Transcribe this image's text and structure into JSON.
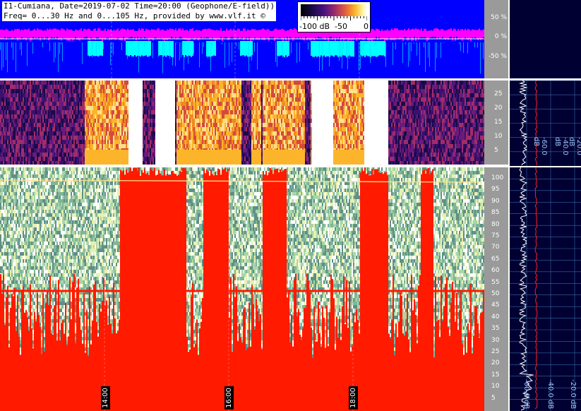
{
  "header": {
    "line1": "I1-Cumiana, Date=2019-07-02 Time=20:00 (Geophone/E-field))",
    "line2": "Freq= 0...30 Hz and 0...105 Hz, provided by www.vlf.it ©"
  },
  "colorbar": {
    "labels": [
      "-100 dB",
      "-50",
      "0"
    ]
  },
  "top_axis": {
    "ticks": [
      "50 %",
      "0 %",
      "-50 %"
    ]
  },
  "mid_axis": {
    "ticks": [
      "25",
      "20",
      "15",
      "10",
      "5"
    ]
  },
  "bottom_axis": {
    "ticks": [
      "100",
      "95",
      "90",
      "85",
      "80",
      "75",
      "70",
      "65",
      "60",
      "55",
      "50",
      "45",
      "40",
      "35",
      "30",
      "25",
      "20",
      "15",
      "10",
      "5"
    ]
  },
  "mid_spectrum": {
    "db_labels": [
      "-60.0 dB",
      "-40.0 dB",
      "-20.0 dB"
    ]
  },
  "bottom_spectrum": {
    "db_labels": [
      "-60.0 dB",
      "-40.0 dB",
      "-20.0 dB"
    ]
  },
  "time_labels": [
    "14:00",
    "16:00",
    "18:00"
  ],
  "colors": {
    "amplitude_bg": "#0000ff",
    "amplitude_magenta": "#ff00ff",
    "amplitude_cyan": "#00ffff",
    "spectrogram_hot": "#ff1a00",
    "spectrogram_cool": "#5f8f87",
    "axis_bg": "#9a9a9a",
    "spectrum_bg": "#000033"
  }
}
